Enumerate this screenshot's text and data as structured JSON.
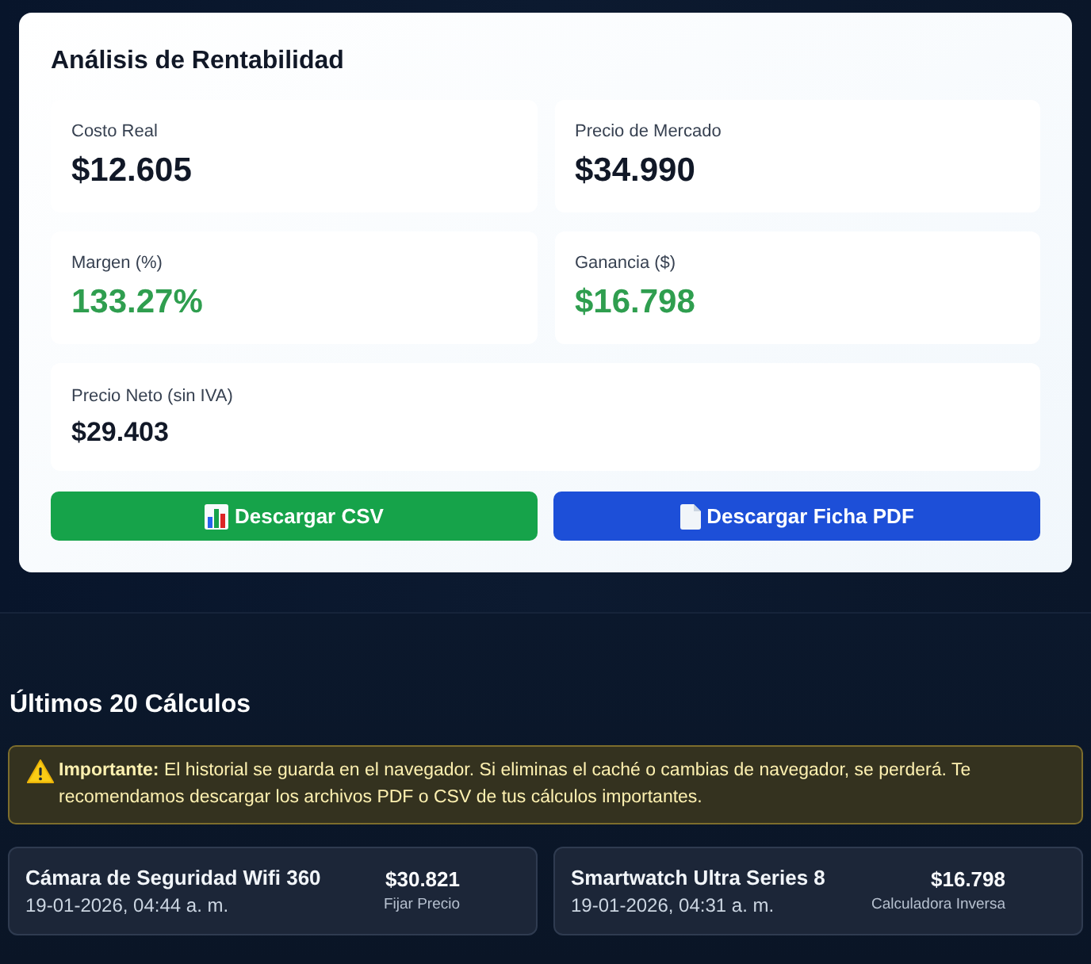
{
  "analysis": {
    "title": "Análisis de Rentabilidad",
    "metrics": [
      {
        "label": "Costo Real",
        "value": "$12.605",
        "kind": "main"
      },
      {
        "label": "Precio de Mercado",
        "value": "$34.990",
        "kind": "main"
      },
      {
        "label": "Margen (%)",
        "value": "133.27%",
        "kind": "positive"
      },
      {
        "label": "Ganancia ($)",
        "value": "$16.798",
        "kind": "positive"
      },
      {
        "label": "Precio Neto (sin IVA)",
        "value": "$29.403",
        "kind": "minor"
      }
    ],
    "buttons": [
      {
        "label": "Descargar CSV",
        "kind": "csv"
      },
      {
        "label": "Descargar Ficha PDF",
        "kind": "pdf"
      }
    ]
  },
  "history": {
    "title": "Últimos 20 Cálculos",
    "notice": "**Importante:** El historial se guarda en el navegador. Si eliminas el caché o cambias de navegador, se perderá. Te recomendamos descargar los archivos PDF o CSV de tus cálculos importantes.",
    "items": [
      {
        "name": "Cámara de Seguridad Wifi 360",
        "date": "19-01-2026, 04:44 a. m.",
        "amount": "$30.821",
        "type": "Fijar Precio"
      },
      {
        "name": "Smartwatch Ultra Series 8",
        "date": "19-01-2026, 04:31 a. m.",
        "amount": "$16.798",
        "type": "Calculadora Inversa"
      }
    ]
  }
}
